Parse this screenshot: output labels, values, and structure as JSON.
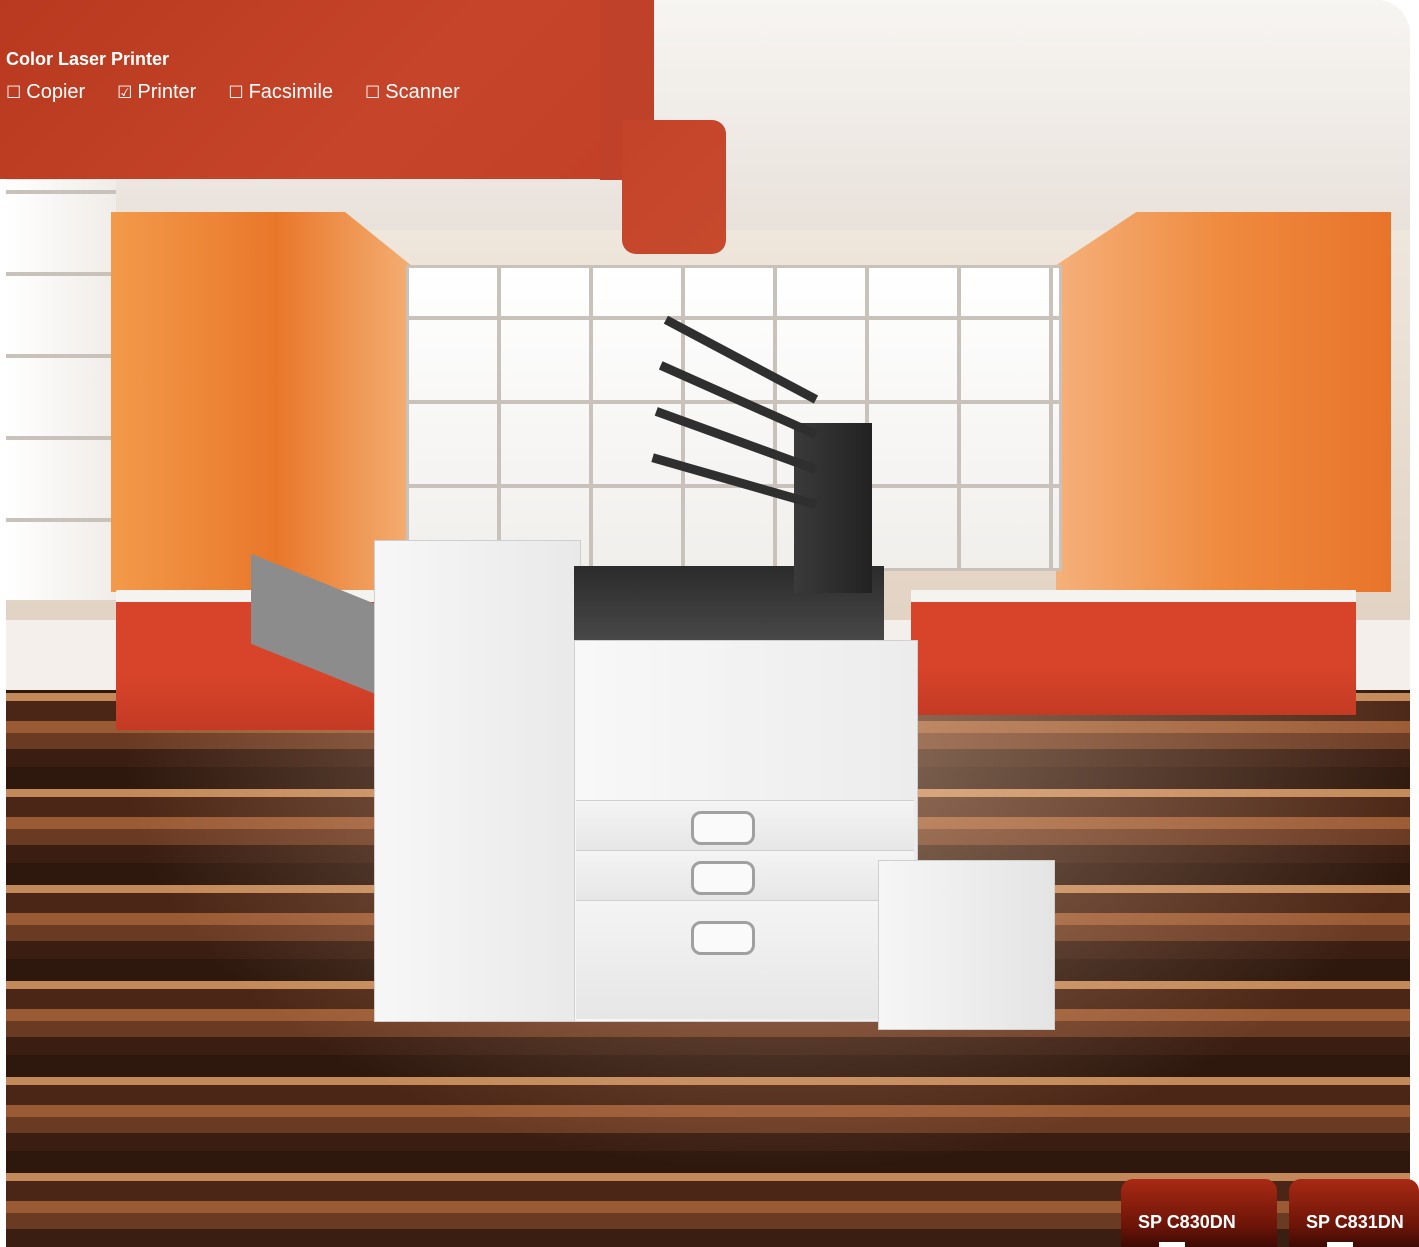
{
  "header": {
    "title": "Color Laser Printer",
    "categories": [
      {
        "label": "Copier",
        "checked": false
      },
      {
        "label": "Printer",
        "checked": true
      },
      {
        "label": "Facsimile",
        "checked": false
      },
      {
        "label": "Scanner",
        "checked": false
      }
    ],
    "checked_symbol": "☑",
    "unchecked_symbol": "☐",
    "color": "#c0412a"
  },
  "models": [
    {
      "label": "SP C830DN"
    },
    {
      "label": "SP C831DN"
    }
  ],
  "colors": {
    "accent": "#c0412a",
    "tab": "#6b1408"
  }
}
